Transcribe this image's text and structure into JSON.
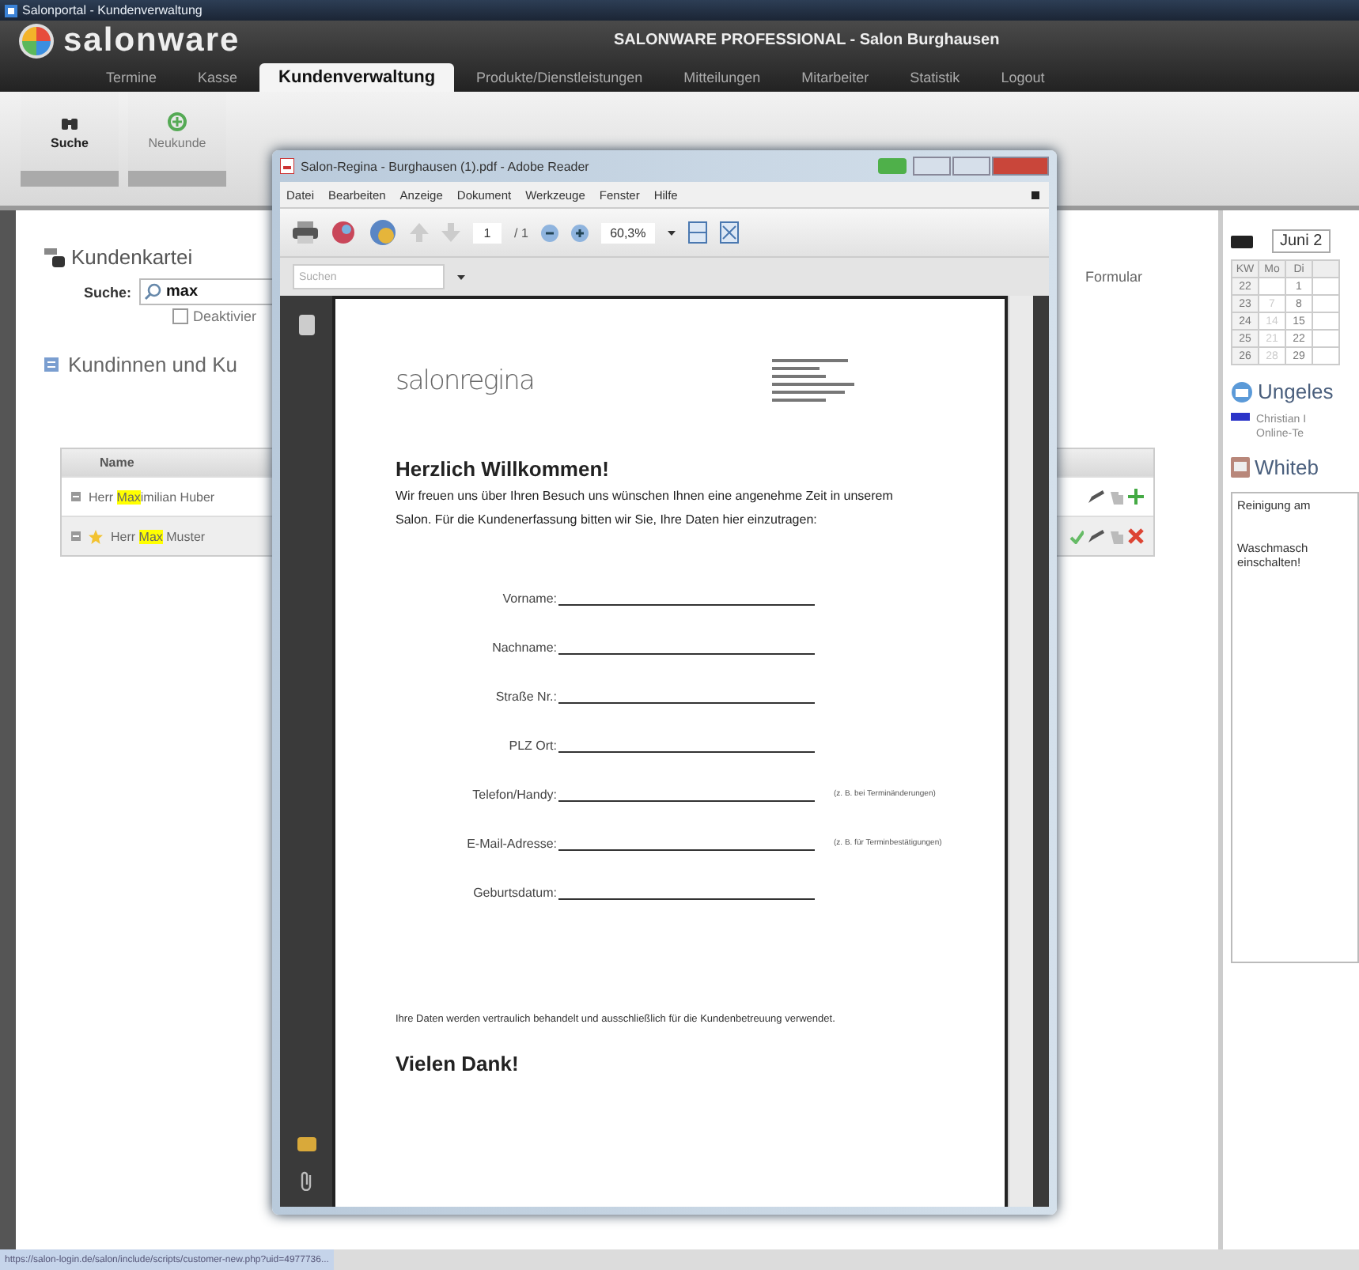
{
  "window": {
    "title": "Salonportal - Kundenverwaltung"
  },
  "header": {
    "logo": "salonware",
    "title": "SALONWARE PROFESSIONAL - Salon Burghausen"
  },
  "nav": [
    {
      "label": "Termine",
      "selected": false
    },
    {
      "label": "Kasse",
      "selected": false
    },
    {
      "label": "Kundenverwaltung",
      "selected": true
    },
    {
      "label": "Produkte/Dienstleistungen",
      "selected": false
    },
    {
      "label": "Mitteilungen",
      "selected": false
    },
    {
      "label": "Mitarbeiter",
      "selected": false
    },
    {
      "label": "Statistik",
      "selected": false
    },
    {
      "label": "Logout",
      "selected": false
    }
  ],
  "toolbar": [
    {
      "label": "Suche",
      "kind": "search",
      "selected": true
    },
    {
      "label": "Neukunde",
      "kind": "new",
      "selected": false
    }
  ],
  "customer_card": {
    "title": "Kundenkartei",
    "search_label": "Suche:",
    "search_value": "max",
    "deactivated": {
      "label": "Deaktivier",
      "checked": false
    },
    "list_title": "Kundinnen und Ku",
    "form_link": "Formular",
    "table": {
      "columns": [
        "Name"
      ],
      "rows": [
        {
          "prefix": "Herr ",
          "match": "Max",
          "suffix": "imilian Huber",
          "starred": false,
          "kind": "add"
        },
        {
          "prefix": "Herr ",
          "match": "Max",
          "suffix": " Muster",
          "starred": true,
          "kind": "delete"
        }
      ]
    }
  },
  "sidebar": {
    "calendar": {
      "month": "Juni 2",
      "columns": [
        "KW",
        "Mo",
        "Di"
      ],
      "rows": [
        [
          "22",
          "",
          "1"
        ],
        [
          "23",
          "7",
          "8"
        ],
        [
          "24",
          "14",
          "15"
        ],
        [
          "25",
          "21",
          "22"
        ],
        [
          "26",
          "28",
          "29"
        ]
      ]
    },
    "unread": {
      "title": "Ungeles",
      "items": [
        {
          "lines": [
            "Christian I",
            "Online-Te"
          ]
        }
      ]
    },
    "whiteboard": {
      "title": "Whiteb",
      "paragraphs": [
        "Reinigung am",
        "Waschmasch\neinschalten!"
      ]
    }
  },
  "pdf_viewer": {
    "title": "Salon-Regina - Burghausen (1).pdf - Adobe Reader",
    "menu": [
      "Datei",
      "Bearbeiten",
      "Anzeige",
      "Dokument",
      "Werkzeuge",
      "Fenster",
      "Hilfe"
    ],
    "page": "1",
    "page_count": "/ 1",
    "zoom": "60,3%",
    "search_placeholder": "Suchen",
    "document": {
      "logo": "salonregina",
      "heading": "Herzlich Willkommen!",
      "intro": "Wir freuen uns über Ihren Besuch uns wünschen Ihnen eine angenehme Zeit in unserem Salon. Für die Kundenerfassung bitten wir Sie, Ihre Daten hier einzutragen:",
      "fields": [
        {
          "label": "Vorname:"
        },
        {
          "label": "Nachname:"
        },
        {
          "label": "Straße Nr.:"
        },
        {
          "label": "PLZ Ort:"
        },
        {
          "label": "Telefon/Handy:",
          "hint": "(z. B. bei Terminänderungen)"
        },
        {
          "label": "E-Mail-Adresse:",
          "hint": "(z. B. für Terminbestätigungen)"
        },
        {
          "label": "Geburtsdatum:"
        }
      ],
      "footer": "Ihre Daten werden vertraulich behandelt und ausschließlich für die Kundenbetreuung verwendet.",
      "closing": "Vielen Dank!"
    }
  },
  "status_bar": {
    "url": "https://salon-login.de/salon/include/scripts/customer-new.php?uid=4977736..."
  }
}
